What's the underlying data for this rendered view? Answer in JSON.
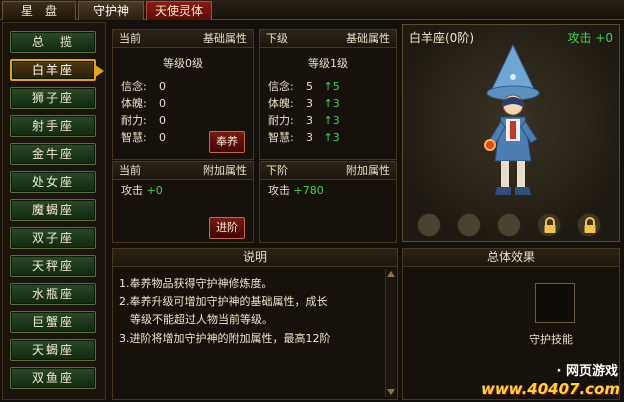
{
  "tabs": [
    {
      "label": "星　盘"
    },
    {
      "label": "守护神"
    },
    {
      "label": "天使灵体"
    }
  ],
  "sidebar": {
    "items": [
      {
        "label": "总　揽"
      },
      {
        "label": "白羊座"
      },
      {
        "label": "狮子座"
      },
      {
        "label": "射手座"
      },
      {
        "label": "金牛座"
      },
      {
        "label": "处女座"
      },
      {
        "label": "魔蝎座"
      },
      {
        "label": "双子座"
      },
      {
        "label": "天秤座"
      },
      {
        "label": "水瓶座"
      },
      {
        "label": "巨蟹座"
      },
      {
        "label": "天蝎座"
      },
      {
        "label": "双鱼座"
      }
    ],
    "selected": "白羊座"
  },
  "current_base": {
    "title_left": "当前",
    "title_right": "基础属性",
    "level": "等级0级",
    "attrs": [
      {
        "name": "信念:",
        "value": "0"
      },
      {
        "name": "体魄:",
        "value": "0"
      },
      {
        "name": "耐力:",
        "value": "0"
      },
      {
        "name": "智慧:",
        "value": "0"
      }
    ],
    "button": "奉养"
  },
  "next_base": {
    "title_left": "下级",
    "title_right": "基础属性",
    "level": "等级1级",
    "attrs": [
      {
        "name": "信念:",
        "value": "5",
        "delta": "↑5"
      },
      {
        "name": "体魄:",
        "value": "3",
        "delta": "↑3"
      },
      {
        "name": "耐力:",
        "value": "3",
        "delta": "↑3"
      },
      {
        "name": "智慧:",
        "value": "3",
        "delta": "↑3"
      }
    ]
  },
  "current_extra": {
    "title_left": "当前",
    "title_right": "附加属性",
    "attack_label": "攻击",
    "attack_value": "+0",
    "button": "进阶"
  },
  "next_extra": {
    "title_left": "下阶",
    "title_right": "附加属性",
    "attack_label": "攻击",
    "attack_value": "+780"
  },
  "preview": {
    "name": "白羊座(0阶)",
    "attack": "攻击 +0"
  },
  "description": {
    "title": "说明",
    "lines": [
      "1.奉养物品获得守护神修炼度。",
      "2.奉养升级可增加守护神的基础属性，成长",
      "　等级不能超过人物当前等级。",
      "3.进阶将增加守护神的附加属性，最高12阶"
    ]
  },
  "overall": {
    "title": "总体效果",
    "skill_label": "守护技能"
  },
  "watermark": {
    "line1": "· 网页游戏",
    "line2": "www.40407.com"
  },
  "colors": {
    "accent": "#e8a020",
    "positive": "#3fd24a",
    "button_red": "#7a1a10"
  }
}
